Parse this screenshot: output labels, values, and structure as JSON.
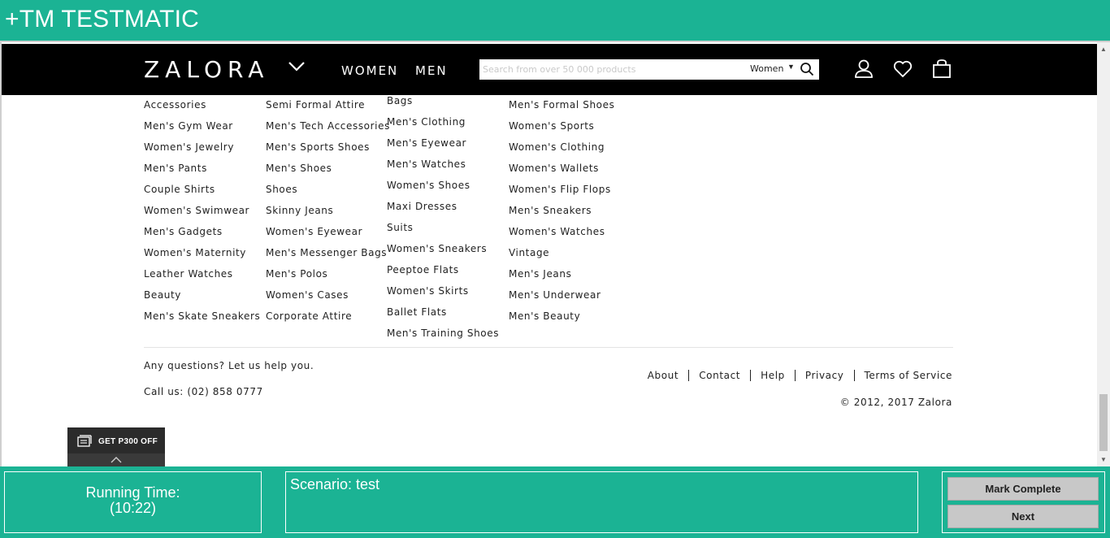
{
  "app": {
    "title": "+TM TESTMATIC"
  },
  "site": {
    "logo": "ZALORA",
    "nav": [
      "WOMEN",
      "MEN"
    ],
    "search": {
      "placeholder": "Search from over 50 000 products",
      "category": "Women"
    },
    "icons": [
      "chevron-down-icon",
      "search-icon",
      "user-icon",
      "heart-icon",
      "bag-icon"
    ]
  },
  "columns": [
    [
      "Accessories",
      "Men's Gym Wear",
      "Women's Jewelry",
      "Men's Pants",
      "Couple Shirts",
      "Women's Swimwear",
      "Men's Gadgets",
      "Women's Maternity",
      "Leather Watches",
      "Beauty",
      "Men's Skate Sneakers"
    ],
    [
      "Semi Formal Attire",
      "Men's Tech Accessories",
      "Men's Sports Shoes",
      "Men's Shoes",
      "Shoes",
      "Skinny Jeans",
      "Women's Eyewear",
      "Men's Messenger Bags",
      "Men's Polos",
      "Women's Cases",
      "Corporate Attire"
    ],
    [
      "Bags",
      "Men's Clothing",
      "Men's Eyewear",
      "Men's Watches",
      "Women's Shoes",
      "Maxi Dresses",
      "Suits",
      "Women's Sneakers",
      "Peeptoe Flats",
      "Women's Skirts",
      "Ballet Flats",
      "Men's Training Shoes"
    ],
    [
      "Men's Formal Shoes",
      "Women's Sports",
      "Women's Clothing",
      "Women's Wallets",
      "Women's Flip Flops",
      "Men's Sneakers",
      "Women's Watches",
      "Vintage",
      "Men's Jeans",
      "Men's Underwear",
      "Men's Beauty"
    ]
  ],
  "footer": {
    "help_text": "Any questions? Let us help you.",
    "call_text": "Call us: (02) 858 0777",
    "links": [
      "About",
      "Contact",
      "Help",
      "Privacy",
      "Terms of Service"
    ],
    "copyright": "© 2012, 2017 Zalora"
  },
  "promo": {
    "label": "GET P300 OFF"
  },
  "testmatic": {
    "running_time_label": "Running Time:",
    "running_time_value": "(10:22)",
    "scenario": "Scenario: test",
    "mark_complete": "Mark Complete",
    "next": "Next"
  },
  "colors": {
    "testmatic": "#1bb394",
    "header": "#000000"
  }
}
